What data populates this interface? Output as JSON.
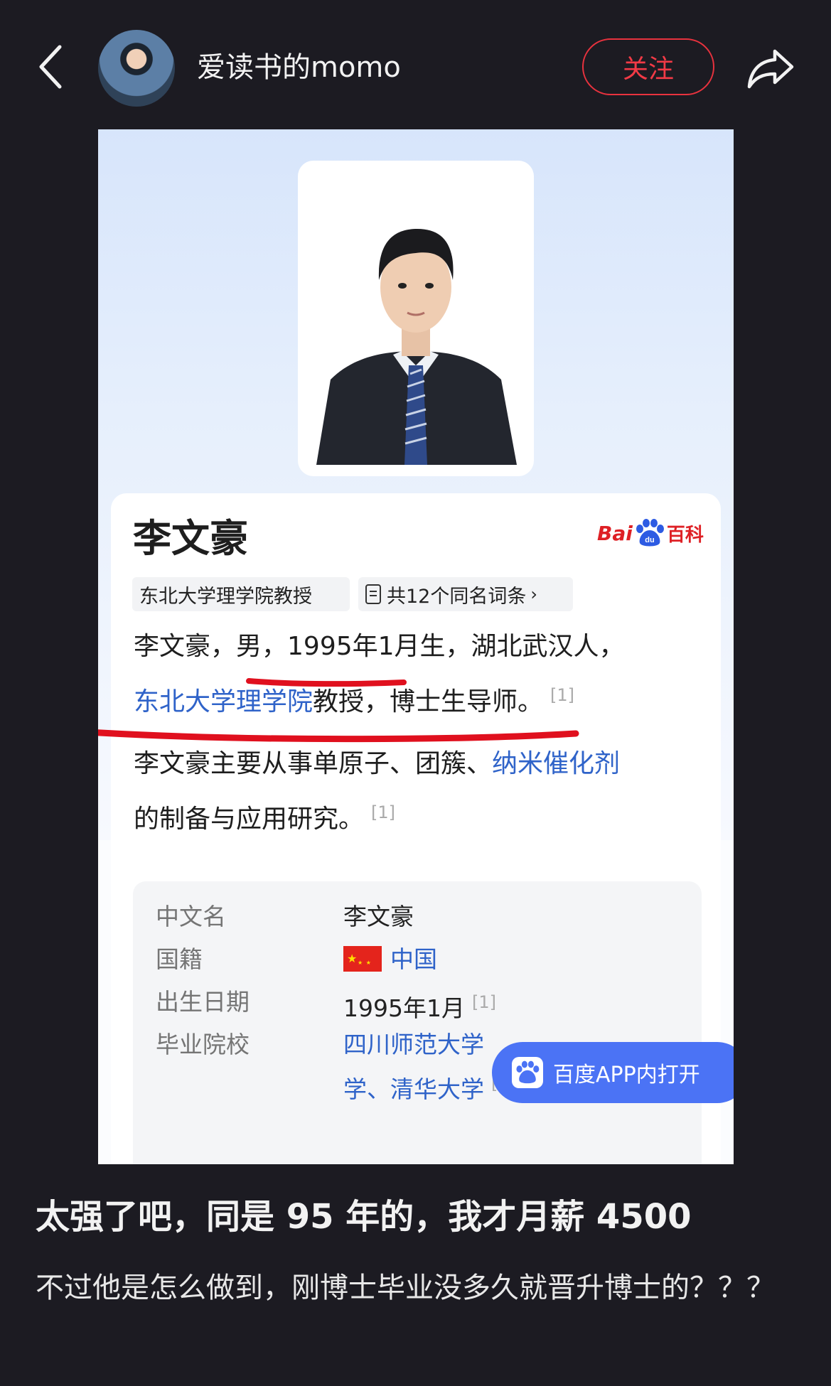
{
  "header": {
    "username": "爱读书的momo",
    "follow_label": "关注",
    "icons": {
      "back": "back-arrow-icon",
      "share": "share-icon"
    }
  },
  "screenshot": {
    "name": "李文豪",
    "logo": {
      "prefix": "Bai",
      "paw_text": "du",
      "suffix": "百科"
    },
    "tag_title": "东北大学理学院教授",
    "tag_homonym": "共12个同名词条",
    "para1": {
      "a": "李文豪，男，",
      "b": "1995年1月生，",
      "c": "湖北武汉人，"
    },
    "para2": {
      "link": "东北大学理学院",
      "rest": "教授，博士生导师。",
      "cite": "[1]"
    },
    "para3": {
      "a": "李文豪主要从事单原子、团簇、",
      "link": "纳米催化剂"
    },
    "para4": {
      "text": "的制备与应用研究。",
      "cite": "[1]"
    },
    "info_table": {
      "rows": [
        {
          "label": "中文名",
          "value": "李文豪"
        },
        {
          "label": "国籍",
          "value": "中国"
        },
        {
          "label": "出生日期",
          "value": "1995年1月",
          "cite": "[1]"
        },
        {
          "label": "毕业院校",
          "value_line1": "四川师范大学",
          "value_line2": "学、清华大学",
          "cite": "[1]"
        }
      ]
    },
    "app_open_label": "百度APP内打开",
    "colors": {
      "link": "#2f63c9",
      "brand_red": "#de2025",
      "app_button": "#4b73f5",
      "annotation_red": "#e0101e"
    }
  },
  "post": {
    "title": "太强了吧，同是 95 年的，我才月薪 4500",
    "body": "不过他是怎么做到，刚博士毕业没多久就晋升博士的？？？"
  }
}
